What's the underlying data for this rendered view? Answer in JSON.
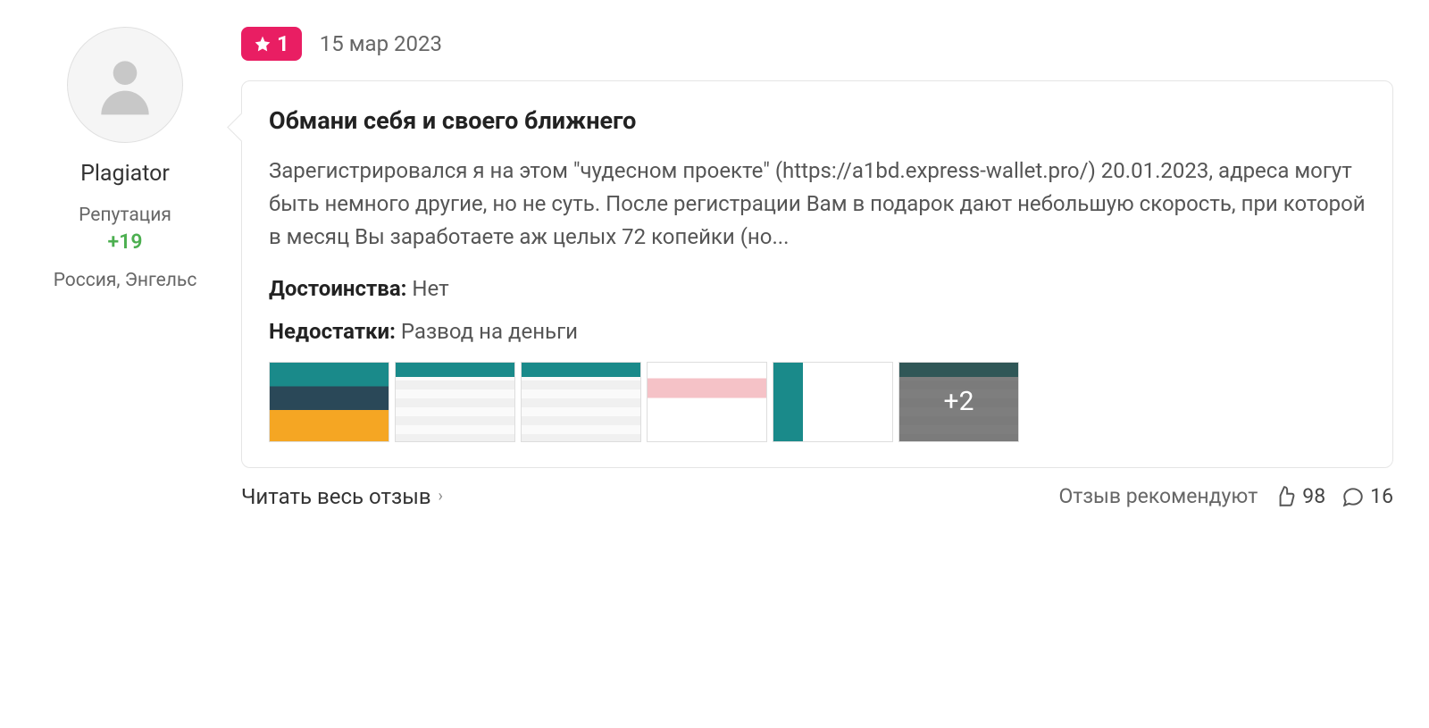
{
  "user": {
    "name": "Plagiator",
    "reputation_label": "Репутация",
    "reputation_value": "+19",
    "location": "Россия, Энгельс"
  },
  "review": {
    "rating": "1",
    "date": "15 мар 2023",
    "title": "Обмани себя и своего ближнего",
    "text": "Зарегистрировался я на этом \"чудесном проекте\" (https://a1bd.express-wallet.pro/) 20.01.2023, адреса могут быть немного другие, но не суть. После регистрации Вам в подарок дают небольшую скорость, при которой в месяц Вы заработаете аж целых 72 копейки (но...",
    "pros_label": "Достоинства:",
    "pros_value": "Нет",
    "cons_label": "Недостатки:",
    "cons_value": "Развод на деньги",
    "more_overlay": "+2"
  },
  "footer": {
    "read_more": "Читать весь отзыв",
    "recommend": "Отзыв рекомендуют",
    "likes": "98",
    "comments": "16"
  }
}
